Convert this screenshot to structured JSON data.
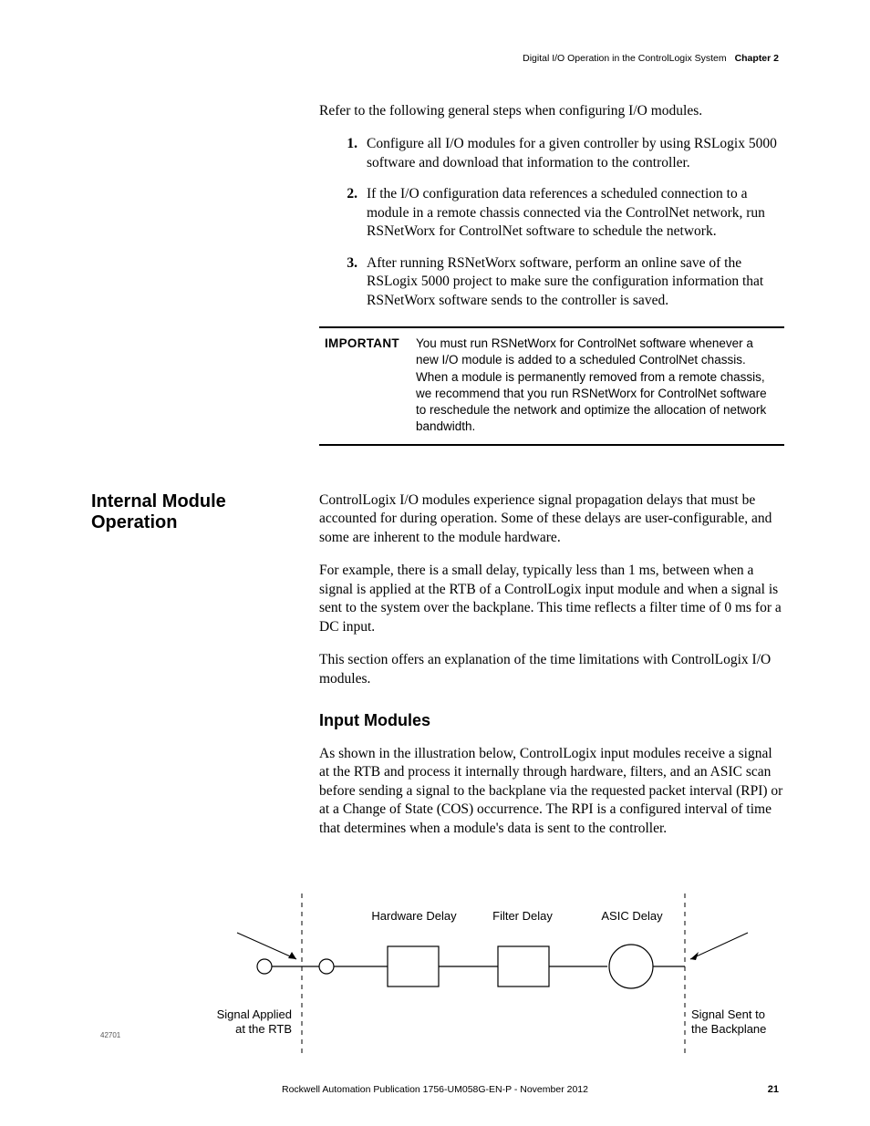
{
  "header": {
    "section_title": "Digital I/O Operation in the ControlLogix System",
    "chapter": "Chapter 2"
  },
  "intro": "Refer to the following general steps when configuring I/O modules.",
  "steps": [
    "Configure all I/O modules for a given controller by using RSLogix 5000 software and download that information to the controller.",
    "If the I/O configuration data references a scheduled connection to a module in a remote chassis connected via the ControlNet network, run RSNetWorx for ControlNet software to schedule the network.",
    "After running RSNetWorx software, perform an online save of the RSLogix 5000 project to make sure the configuration information that RSNetWorx software sends to the controller is saved."
  ],
  "important": {
    "label": "IMPORTANT",
    "text": "You must run RSNetWorx for ControlNet software whenever a new I/O module is added to a scheduled ControlNet chassis. When a module is permanently removed from a remote chassis, we recommend that you run RSNetWorx for ControlNet software to reschedule the network and optimize the allocation of network bandwidth."
  },
  "section": {
    "heading": "Internal Module Operation",
    "p1": "ControlLogix I/O modules experience signal propagation delays that must be accounted for during operation. Some of these delays are user-configurable, and some are inherent to the module hardware.",
    "p2": "For example, there is a small delay, typically less than 1 ms, between when a signal is applied at the RTB of a ControlLogix input module and when a signal is sent to the system over the backplane. This time reflects a filter time of 0 ms for a DC input.",
    "p3": "This section offers an explanation of the time limitations with ControlLogix I/O modules.",
    "sub_heading": "Input Modules",
    "p4": "As shown in the illustration below, ControlLogix input modules receive a signal at the RTB and process it internally through hardware, filters, and an ASIC scan before sending a signal to the backplane via the requested packet interval (RPI) or at a Change of State (COS) occurrence. The RPI is a configured interval of time that determines when a module's data is sent to the controller."
  },
  "diagram": {
    "id": "42701",
    "hw": "Hardware Delay",
    "fd": "Filter Delay",
    "ad": "ASIC Delay",
    "sig_left_l1": "Signal Applied",
    "sig_left_l2": "at the RTB",
    "sig_right_l1": "Signal Sent to",
    "sig_right_l2": "the Backplane"
  },
  "footer": {
    "pub": "Rockwell Automation Publication 1756-UM058G-EN-P - November 2012",
    "page": "21"
  }
}
